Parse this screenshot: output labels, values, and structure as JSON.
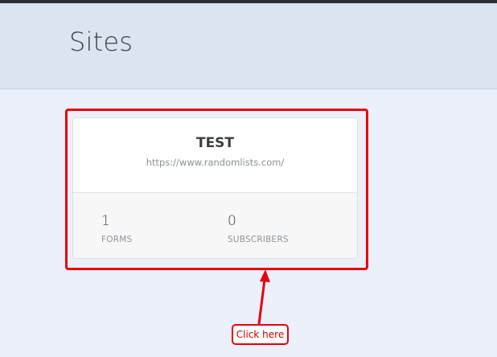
{
  "header": {
    "title": "Sites"
  },
  "site_card": {
    "name": "TEST",
    "url": "https://www.randomlists.com/",
    "stats": [
      {
        "value": "1",
        "label": "FORMS"
      },
      {
        "value": "0",
        "label": "SUBSCRIBERS"
      }
    ]
  },
  "annotation": {
    "callout_text": "Click here",
    "color": "#e8000d"
  },
  "colors": {
    "page_background": "#ebf0fa",
    "header_background": "#dbe5f1",
    "card_bottom": "#f7f7f7"
  }
}
